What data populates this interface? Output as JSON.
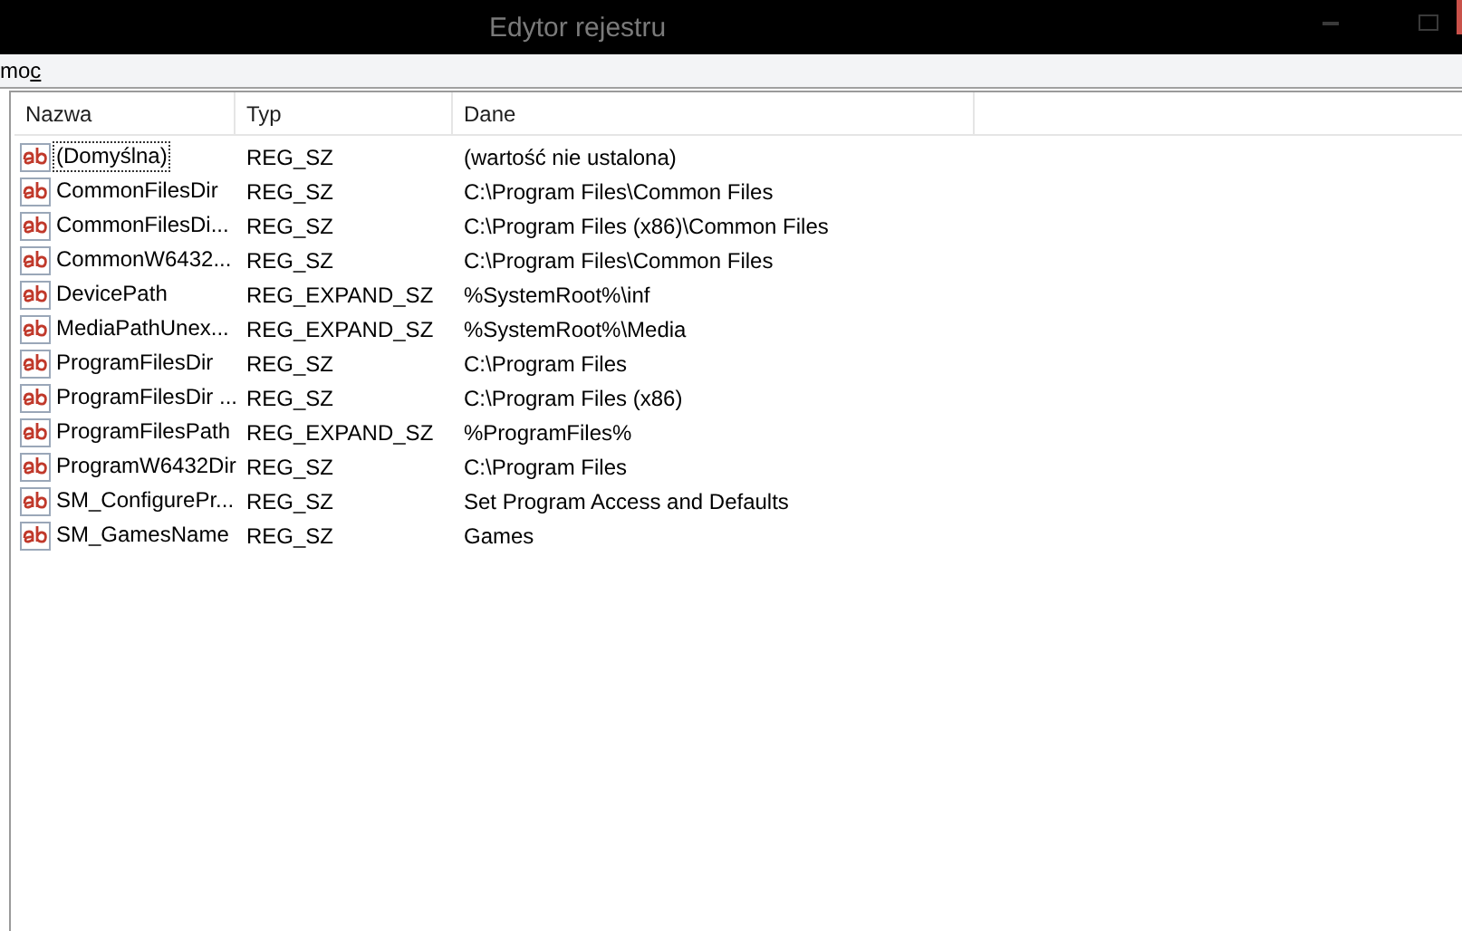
{
  "window": {
    "title": "Edytor rejestru"
  },
  "menu": [
    {
      "text": "mo",
      "access_key": "c"
    }
  ],
  "table": {
    "columns": [
      "Nazwa",
      "Typ",
      "Dane"
    ],
    "rows": [
      {
        "name": "(Domyślna)",
        "type": "REG_SZ",
        "data": "(wartość nie ustalona)",
        "focused": true
      },
      {
        "name": "CommonFilesDir",
        "type": "REG_SZ",
        "data": "C:\\Program Files\\Common Files",
        "focused": false
      },
      {
        "name": "CommonFilesDi...",
        "type": "REG_SZ",
        "data": "C:\\Program Files (x86)\\Common Files",
        "focused": false
      },
      {
        "name": "CommonW6432...",
        "type": "REG_SZ",
        "data": "C:\\Program Files\\Common Files",
        "focused": false
      },
      {
        "name": "DevicePath",
        "type": "REG_EXPAND_SZ",
        "data": "%SystemRoot%\\inf",
        "focused": false
      },
      {
        "name": "MediaPathUnex...",
        "type": "REG_EXPAND_SZ",
        "data": "%SystemRoot%\\Media",
        "focused": false
      },
      {
        "name": "ProgramFilesDir",
        "type": "REG_SZ",
        "data": "C:\\Program Files",
        "focused": false
      },
      {
        "name": "ProgramFilesDir ...",
        "type": "REG_SZ",
        "data": "C:\\Program Files (x86)",
        "focused": false
      },
      {
        "name": "ProgramFilesPath",
        "type": "REG_EXPAND_SZ",
        "data": "%ProgramFiles%",
        "focused": false
      },
      {
        "name": "ProgramW6432Dir",
        "type": "REG_SZ",
        "data": "C:\\Program Files",
        "focused": false
      },
      {
        "name": "SM_ConfigurePr...",
        "type": "REG_SZ",
        "data": "Set Program Access and Defaults",
        "focused": false
      },
      {
        "name": "SM_GamesName",
        "type": "REG_SZ",
        "data": "Games",
        "focused": false
      }
    ]
  }
}
